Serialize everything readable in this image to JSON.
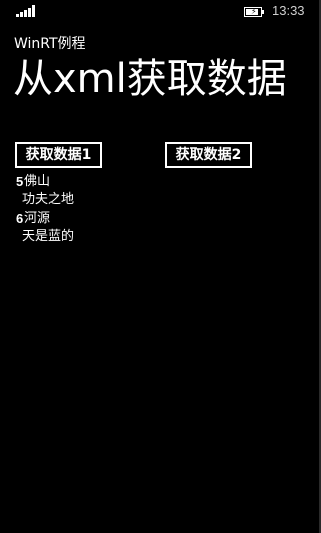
{
  "status_bar": {
    "time": "13:33",
    "signal_icon": "cellular-signal-icon",
    "battery_icon": "battery-charging-icon"
  },
  "header": {
    "app_title": "WinRT例程",
    "page_title": "从xml获取数据"
  },
  "buttons": {
    "get_data_1": "获取数据1",
    "get_data_2": "获取数据2"
  },
  "results": [
    {
      "id": "5",
      "name": "佛山",
      "description": "功夫之地"
    },
    {
      "id": "6",
      "name": "河源",
      "description": "天是蓝的"
    }
  ]
}
